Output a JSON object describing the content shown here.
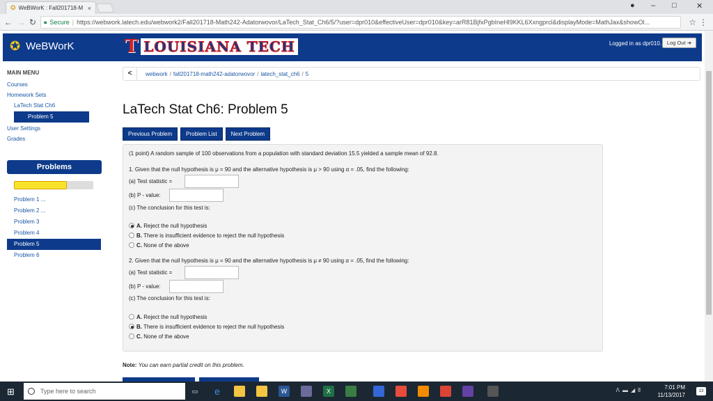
{
  "browser": {
    "tab_title": "WeBWorK : Fall201718-M",
    "tab_close": "×",
    "win_minimize": "–",
    "win_maximize": "□",
    "win_close": "✕",
    "secure_label": "Secure",
    "url": "https://webwork.latech.edu/webwork2/Fall201718-Math242-Adatorwovor/LaTech_Stat_Ch6/5/?user=dpr010&effectiveUser=dpr010&key=arR81BjfxPgbIneHl9KKL6Xxngprcl&displayMode=MathJax&showOl..."
  },
  "header": {
    "brand": "WeBWorK",
    "lt_letter": "T",
    "lt_name": "LOUISIANA TECH",
    "logged_in": "Logged in as dpr010.",
    "logout": "Log Out"
  },
  "sidebar": {
    "menu_title": "MAIN MENU",
    "courses": "Courses",
    "homework_sets": "Homework Sets",
    "set_name": "LaTech Stat Ch6",
    "current_problem": "Problem 5",
    "user_settings": "User Settings",
    "grades": "Grades",
    "problems_title": "Problems",
    "progress_fraction": 0.67,
    "problem_items": [
      "Problem 1 ...",
      "Problem 2 ...",
      "Problem 3",
      "Problem 4",
      "Problem 5",
      "Problem 6"
    ]
  },
  "main": {
    "crumb_back": "<",
    "crumbs": [
      "webwork",
      "fall201718-math242-adatorwovor",
      "latech_stat_ch6",
      "5"
    ],
    "crumb_sep": "/",
    "title": "LaTech Stat Ch6: Problem 5",
    "btn_prev": "Previous Problem",
    "btn_list": "Problem List",
    "btn_next": "Next Problem",
    "intro": "(1 point) A random sample of 100 observations from a population with standard deviation 15.5 yielded a sample mean of 92.8.",
    "q1": {
      "prompt": "1. Given that the null hypothesis is μ = 90 and the alternative hypothesis is μ > 90 using α = .05, find the following:",
      "a": "(a) Test statistic =",
      "b": "(b) P - value:",
      "c": "(c) The conclusion for this test is:",
      "options": [
        {
          "letter": "A.",
          "text": "Reject the null hypothesis"
        },
        {
          "letter": "B.",
          "text": "There is insufficient evidence to reject the null hypothesis"
        },
        {
          "letter": "C.",
          "text": "None of the above"
        }
      ]
    },
    "q2": {
      "prompt": "2. Given that the null hypothesis is μ = 90 and the alternative hypothesis is μ ≠ 90 using α = .05, find the following:",
      "a": "(a) Test statistic =",
      "b": "(b) P - value:",
      "c": "(c) The conclusion for this test is:",
      "options": [
        {
          "letter": "A.",
          "text": "Reject the null hypothesis"
        },
        {
          "letter": "B.",
          "text": "There is insufficient evidence to reject the null hypothesis"
        },
        {
          "letter": "C.",
          "text": "None of the above"
        }
      ]
    },
    "note_label": "Note:",
    "note_text": "You can earn partial credit on this problem."
  },
  "taskbar": {
    "search_placeholder": "Type here to search",
    "time": "7:01 PM",
    "date": "11/13/2017",
    "notif_count": "13"
  }
}
